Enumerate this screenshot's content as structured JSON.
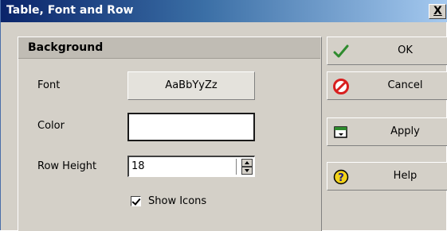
{
  "window": {
    "title": "Table, Font and Row",
    "close_label": "X"
  },
  "panel": {
    "header": "Background",
    "font_label": "Font",
    "font_sample": "AaBbYyZz",
    "color_label": "Color",
    "color_value": "#ffffff",
    "row_height_label": "Row Height",
    "row_height_value": "18",
    "show_icons_label": "Show Icons",
    "show_icons_checked": true
  },
  "buttons": {
    "ok": {
      "label": "OK",
      "icon": "checkmark-icon"
    },
    "cancel": {
      "label": "Cancel",
      "icon": "no-entry-icon"
    },
    "apply": {
      "label": "Apply",
      "icon": "apply-window-icon"
    },
    "help": {
      "label": "Help",
      "icon": "question-icon"
    }
  },
  "colors": {
    "title_bar_start": "#0a246a",
    "title_bar_end": "#a6caf0",
    "dialog_face": "#d4d0c8",
    "ok_green": "#2e8b2e",
    "cancel_red": "#d81e1e",
    "help_yellow": "#f2d21a"
  }
}
